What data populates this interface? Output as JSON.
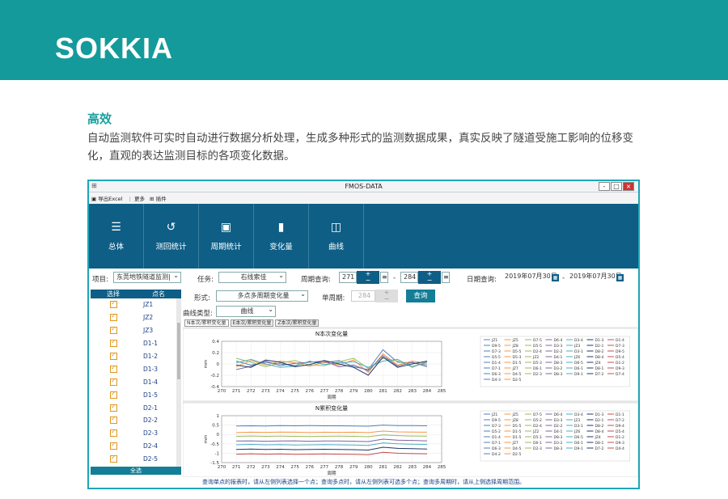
{
  "brand": {
    "logo_text": "SOKKIA",
    "header_color": "#149a9b"
  },
  "section": {
    "title": "高效",
    "description": "自动监测软件可实时自动进行数据分析处理，生成多种形式的监测数据成果，真实反映了隧道受施工影响的位移变化，直观的表达监测目标的各项变化数据。"
  },
  "window": {
    "title": "FMOS-DATA",
    "app_icon": "app-icon",
    "controls": {
      "minimize": "-",
      "maximize": "□",
      "close": "×"
    }
  },
  "menubar": [
    {
      "label": "导出Excel",
      "icon": "export-icon"
    },
    {
      "label": "更多",
      "icon": "more-icon"
    },
    {
      "label": "插件",
      "icon": "plugin-icon"
    }
  ],
  "ribbon": [
    {
      "label": "总体",
      "icon": "list-icon",
      "glyph": "☰"
    },
    {
      "label": "测回统计",
      "icon": "history-icon",
      "glyph": "↺"
    },
    {
      "label": "周期统计",
      "icon": "calendar-stat-icon",
      "glyph": "▣"
    },
    {
      "label": "变化量",
      "icon": "bar-chart-icon",
      "glyph": "▮"
    },
    {
      "label": "曲线",
      "icon": "line-chart-icon",
      "glyph": "◫"
    }
  ],
  "filters": {
    "project_label": "项目:",
    "project_value": "东莞地铁隧道监测|",
    "task_label": "任务:",
    "task_value": "右线索佳",
    "period_query_label": "周期查询:",
    "period_from": "271",
    "period_to": "284",
    "date_query_label": "日期查询:",
    "date_from": "2019年07月30日",
    "date_to": "2019年07月30日",
    "form_label": "形式:",
    "form_value": "多点多周期变化量",
    "single_period_label": "单周期:",
    "single_period_value": "284",
    "query_button": "查询",
    "curve_type_label": "曲线类型:",
    "curve_type_value": "曲线",
    "spin_up": "+",
    "spin_down": "−",
    "dash": "-"
  },
  "tabs": [
    "N本次/累积变化量",
    "E本次/累积变化量",
    "Z本次/累积变化量"
  ],
  "point_list": {
    "header_select": "选择",
    "header_name": "点名",
    "points": [
      "JZ1",
      "JZ2",
      "JZ3",
      "D1-1",
      "D1-2",
      "D1-3",
      "D1-4",
      "D1-5",
      "D2-1",
      "D2-2",
      "D2-3",
      "D2-4",
      "D2-5"
    ],
    "all_button": "全选"
  },
  "status_text": "查询单点的报表时，请从左侧列表选择一个点；查询多点时，请从左侧列表可选多个点；查询多周期时，请从上侧选择周期范围。",
  "chart_data": [
    {
      "type": "line",
      "title": "N本次变化量",
      "xlabel": "周期",
      "ylabel": "mm",
      "x": [
        270,
        271,
        272,
        273,
        274,
        275,
        276,
        277,
        278,
        279,
        280,
        281,
        282,
        283,
        284,
        285
      ],
      "ylim": [
        -0.4,
        0.4
      ],
      "yticks": [
        0.4,
        0.2,
        0,
        -0.2,
        -0.4
      ],
      "grid": true,
      "legend_position": "right",
      "series": [
        {
          "name": "JZ1",
          "color": "#4f81bd",
          "values": [
            null,
            0.05,
            -0.02,
            0.03,
            0.0,
            -0.03,
            0.04,
            0.02,
            0.06,
            -0.05,
            -0.1,
            0.25,
            0.03,
            0.02,
            -0.02,
            null
          ]
        },
        {
          "name": "D1-1",
          "color": "#f79646",
          "values": [
            null,
            -0.05,
            0.06,
            -0.02,
            0.05,
            0.02,
            -0.04,
            0.03,
            -0.02,
            0.07,
            -0.15,
            0.18,
            -0.02,
            0.05,
            0.01,
            null
          ]
        },
        {
          "name": "D2-1",
          "color": "#9bbb59",
          "values": [
            null,
            0.1,
            0.03,
            -0.05,
            0.02,
            0.06,
            -0.02,
            -0.03,
            0.04,
            0.1,
            -0.08,
            0.1,
            0.05,
            -0.04,
            0.02,
            null
          ]
        },
        {
          "name": "D3-1",
          "color": "#8064a2",
          "values": [
            null,
            -0.1,
            -0.04,
            0.05,
            -0.03,
            0.01,
            0.03,
            0.05,
            -0.05,
            -0.02,
            -0.12,
            0.15,
            -0.04,
            0.03,
            -0.05,
            null
          ]
        },
        {
          "name": "D4-1",
          "color": "#4bacc6",
          "values": [
            null,
            0.02,
            0.08,
            0.0,
            -0.06,
            -0.04,
            0.05,
            -0.01,
            0.02,
            0.04,
            -0.06,
            0.05,
            0.08,
            -0.06,
            0.04,
            null
          ]
        },
        {
          "name": "D5-1",
          "color": "#1f3864",
          "values": [
            null,
            -0.02,
            -0.06,
            0.07,
            0.03,
            -0.05,
            -0.01,
            0.06,
            0.0,
            -0.06,
            -0.2,
            0.12,
            -0.06,
            0.0,
            0.05,
            null
          ]
        }
      ],
      "legend": [
        "JZ1",
        "JZ5",
        "D7-5",
        "D6-4",
        "D3-4",
        "D1-3",
        "D1-4",
        "D9-5",
        "JZ8",
        "D5-5",
        "D3-3",
        "JZ3",
        "D2-1",
        "D7-3",
        "D7-3",
        "D5-5",
        "D2-4",
        "D2-2",
        "D3-1",
        "D8-2",
        "D9-5",
        "D5-5",
        "D5-3",
        "JZ2",
        "D4-1",
        "JZ6",
        "D8-4",
        "D5-4",
        "D1-4",
        "D1-5",
        "D5-3",
        "D8-3",
        "D6-5",
        "JZ4",
        "D1-2",
        "D7-1",
        "JZ7",
        "D6-1",
        "D3-2",
        "D6-1",
        "D8-1",
        "D9-3",
        "D6-3",
        "D4-5",
        "D2-3",
        "D8-3",
        "D9-1",
        "D7-2",
        "D7-4",
        "D4-3",
        "D2-5"
      ]
    },
    {
      "type": "line",
      "title": "N累积变化量",
      "xlabel": "周期",
      "ylabel": "mm",
      "x": [
        270,
        271,
        272,
        273,
        274,
        275,
        276,
        277,
        278,
        279,
        280,
        281,
        282,
        283,
        284,
        285
      ],
      "ylim": [
        -1.5,
        1.0
      ],
      "yticks": [
        1,
        0.5,
        0,
        -0.5,
        -1,
        -1.5
      ],
      "grid": true,
      "legend_position": "right",
      "series": [
        {
          "name": "JZ1",
          "color": "#4f81bd",
          "values": [
            null,
            0.45,
            0.46,
            0.45,
            0.47,
            0.46,
            0.47,
            0.46,
            0.46,
            0.45,
            0.44,
            0.5,
            0.47,
            0.47,
            0.46,
            null
          ]
        },
        {
          "name": "D1-1",
          "color": "#f79646",
          "values": [
            null,
            0.1,
            0.12,
            0.11,
            0.13,
            0.12,
            0.1,
            0.12,
            0.11,
            0.12,
            0.1,
            0.18,
            0.14,
            0.13,
            0.12,
            null
          ]
        },
        {
          "name": "D2-1",
          "color": "#9bbb59",
          "values": [
            null,
            -0.1,
            -0.08,
            -0.1,
            -0.09,
            -0.1,
            -0.11,
            -0.1,
            -0.09,
            -0.1,
            -0.12,
            -0.02,
            -0.06,
            -0.08,
            -0.09,
            null
          ]
        },
        {
          "name": "D3-1",
          "color": "#8064a2",
          "values": [
            null,
            -0.35,
            -0.34,
            -0.36,
            -0.35,
            -0.34,
            -0.36,
            -0.35,
            -0.35,
            -0.36,
            -0.38,
            -0.25,
            -0.3,
            -0.32,
            -0.34,
            null
          ]
        },
        {
          "name": "D4-1",
          "color": "#4bacc6",
          "values": [
            null,
            -0.55,
            -0.53,
            -0.55,
            -0.54,
            -0.56,
            -0.55,
            -0.54,
            -0.55,
            -0.56,
            -0.58,
            -0.45,
            -0.5,
            -0.52,
            -0.53,
            null
          ]
        },
        {
          "name": "D5-1",
          "color": "#1f3864",
          "values": [
            null,
            -0.8,
            -0.78,
            -0.8,
            -0.79,
            -0.81,
            -0.8,
            -0.79,
            -0.8,
            -0.81,
            -0.83,
            -0.68,
            -0.74,
            -0.76,
            -0.78,
            null
          ]
        },
        {
          "name": "D6-1",
          "color": "#c0504d",
          "values": [
            null,
            -1.05,
            -1.03,
            -1.05,
            -1.04,
            -1.06,
            -1.05,
            -1.04,
            -1.05,
            -1.06,
            -1.08,
            -0.95,
            -1.0,
            -1.02,
            -1.03,
            null
          ]
        }
      ],
      "legend": [
        "JZ1",
        "JZ5",
        "D7-5",
        "D6-4",
        "D3-4",
        "D1-3",
        "D1-1",
        "D9-5",
        "JZ8",
        "D5-2",
        "D3-3",
        "JZ3",
        "D2-1",
        "D7-2",
        "D7-3",
        "D5-5",
        "D2-4",
        "D2-2",
        "D3-1",
        "D8-2",
        "D9-4",
        "D5-2",
        "D1-5",
        "JZ2",
        "D4-1",
        "JZ6",
        "D8-4",
        "D5-4",
        "D1-4",
        "D1-5",
        "D5-1",
        "D8-3",
        "D6-5",
        "JZ4",
        "D1-2",
        "D7-1",
        "JZ7",
        "D6-1",
        "D3-2",
        "D6-1",
        "D8-1",
        "D9-3",
        "D6-3",
        "D4-5",
        "D2-3",
        "D8-3",
        "D9-1",
        "D7-2",
        "D4-4",
        "D4-2",
        "D2-5"
      ]
    }
  ]
}
